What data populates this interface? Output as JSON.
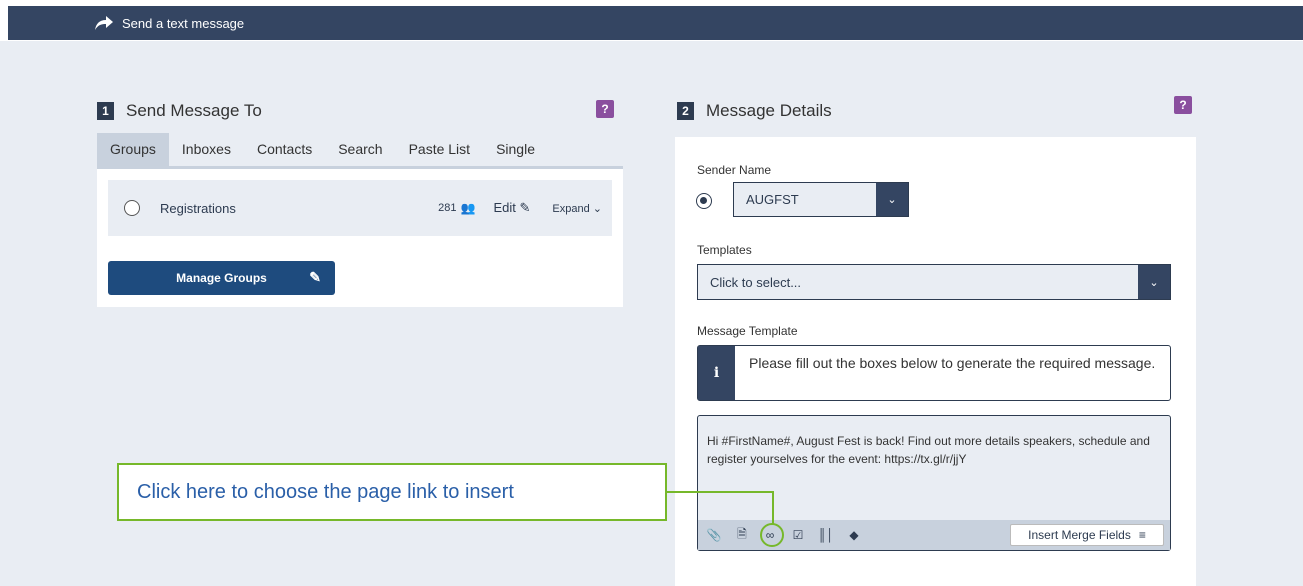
{
  "header": {
    "title": "Send a text message"
  },
  "left_panel": {
    "number": "1",
    "title": "Send Message To",
    "help": "?",
    "tabs": [
      "Groups",
      "Inboxes",
      "Contacts",
      "Search",
      "Paste List",
      "Single"
    ],
    "active_tab": "Groups",
    "group": {
      "name": "Registrations",
      "count": "281",
      "edit_label": "Edit",
      "expand_label": "Expand"
    },
    "manage_button": "Manage Groups"
  },
  "right_panel": {
    "number": "2",
    "title": "Message Details",
    "help": "?",
    "sender_label": "Sender Name",
    "sender_value": "AUGFST",
    "templates_label": "Templates",
    "templates_placeholder": "Click to select...",
    "message_template_label": "Message Template",
    "info_icon": "i",
    "info_text": "Please fill out the boxes below to generate the required message.",
    "message_text": "Hi #FirstName#, August Fest is back! Find out more details speakers, schedule and register yourselves for the event: https://tx.gl/r/jjY",
    "toolbar_icons": [
      "attach-icon",
      "document-icon",
      "link-icon",
      "checkbox-icon",
      "barcode-icon",
      "tag-icon"
    ],
    "merge_button": "Insert Merge Fields"
  },
  "callout": {
    "text": "Click here to choose the page link to insert"
  },
  "colors": {
    "header": "#344562",
    "accent_help": "#8a4f9e",
    "callout_border": "#76b82a",
    "callout_text": "#2a5fa8"
  }
}
